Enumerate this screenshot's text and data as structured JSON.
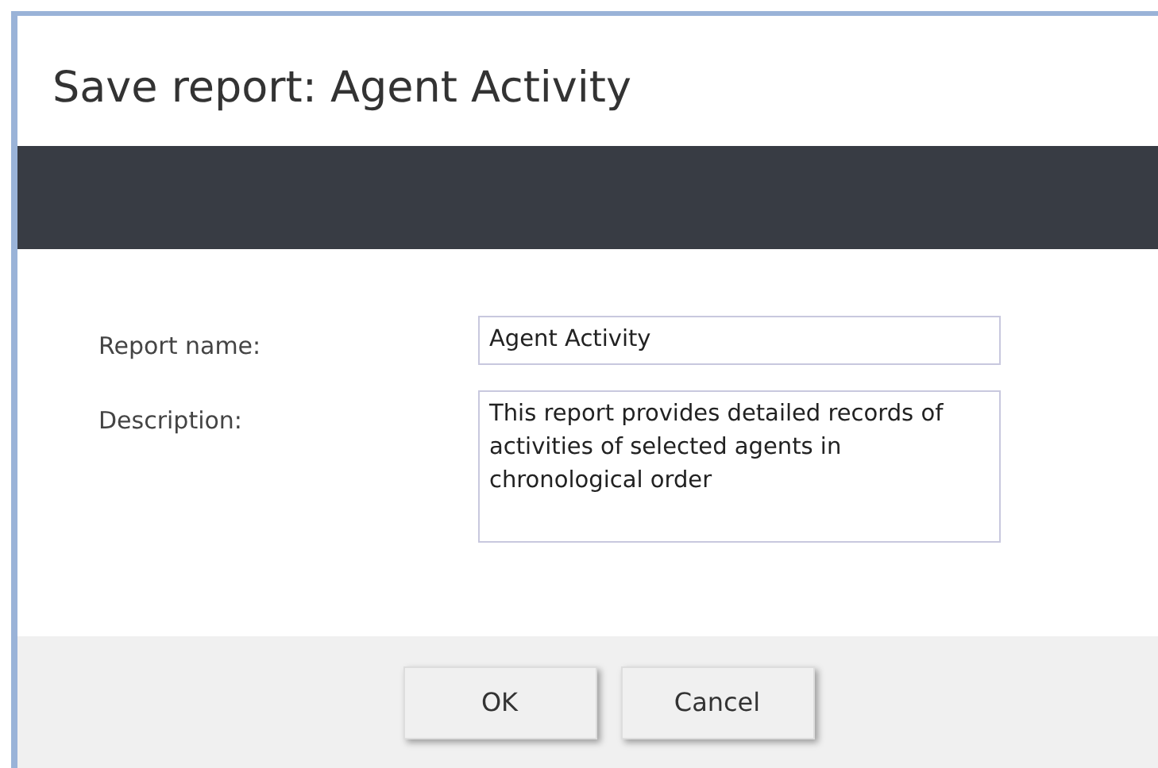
{
  "window": {
    "title": "Save report: Agent Activity"
  },
  "form": {
    "fields": [
      {
        "kind": "input",
        "label": "Report name:",
        "value": "Agent Activity"
      },
      {
        "kind": "textarea",
        "label": "Description:",
        "value": "This report provides detailed records of activities of selected agents in chronological order"
      }
    ]
  },
  "buttons": [
    "OK",
    "Cancel"
  ]
}
